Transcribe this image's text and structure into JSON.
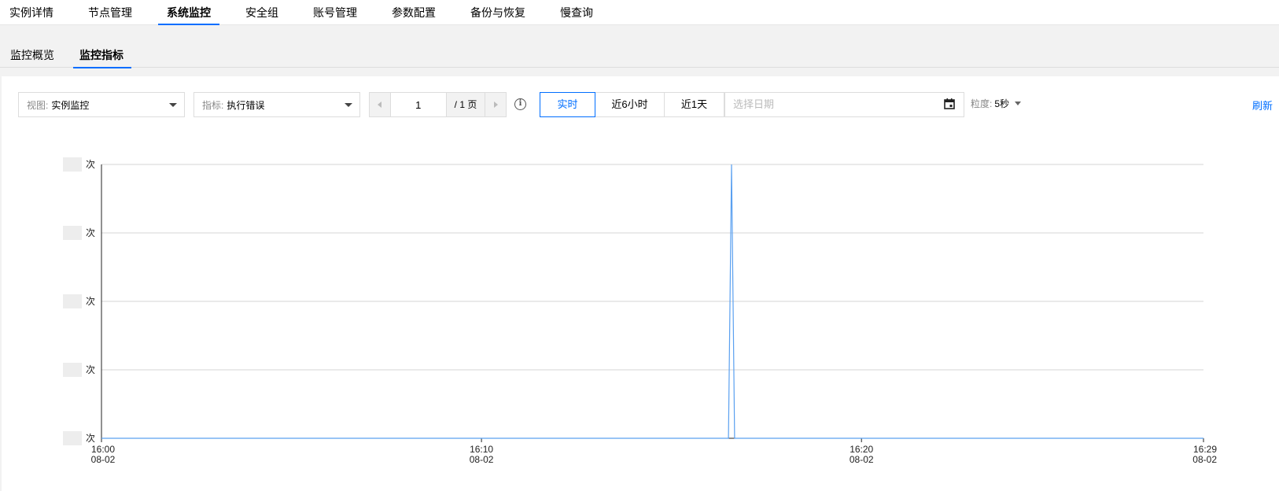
{
  "top_tabs": [
    "实例详情",
    "节点管理",
    "系统监控",
    "安全组",
    "账号管理",
    "参数配置",
    "备份与恢复",
    "慢查询"
  ],
  "top_active": 2,
  "sub_tabs": [
    "监控概览",
    "监控指标"
  ],
  "sub_active": 1,
  "toolbar": {
    "view_label": "视图:",
    "view_value": "实例监控",
    "metric_label": "指标:",
    "metric_value": "执行错误",
    "page_value": "1",
    "page_total": "/ 1 页",
    "info_glyph": "i",
    "time_ranges": [
      "实时",
      "近6小时",
      "近1天"
    ],
    "time_active": 0,
    "date_placeholder": "选择日期",
    "granularity_label": "粒度:",
    "granularity_value": "5秒",
    "refresh_label": "刷新"
  },
  "colors": {
    "accent": "#006eff",
    "series": "#5aa0f0",
    "grid": "#d6d6d6",
    "axis": "#222222"
  },
  "chart_data": {
    "type": "line",
    "ylabels": [
      "次",
      "次",
      "次",
      "次",
      "次"
    ],
    "xticks": [
      {
        "time": "16:00",
        "date": "08-02",
        "minute": 0
      },
      {
        "time": "16:10",
        "date": "08-02",
        "minute": 10
      },
      {
        "time": "16:20",
        "date": "08-02",
        "minute": 20
      },
      {
        "time": "16:29",
        "date": "08-02",
        "minute": 29
      }
    ],
    "xlim": [
      0,
      29
    ],
    "ylim": [
      0,
      4
    ],
    "series": [
      {
        "points": [
          [
            0,
            0
          ],
          [
            16.5,
            0
          ],
          [
            16.58,
            4
          ],
          [
            16.66,
            0
          ],
          [
            29,
            0
          ]
        ]
      }
    ]
  }
}
